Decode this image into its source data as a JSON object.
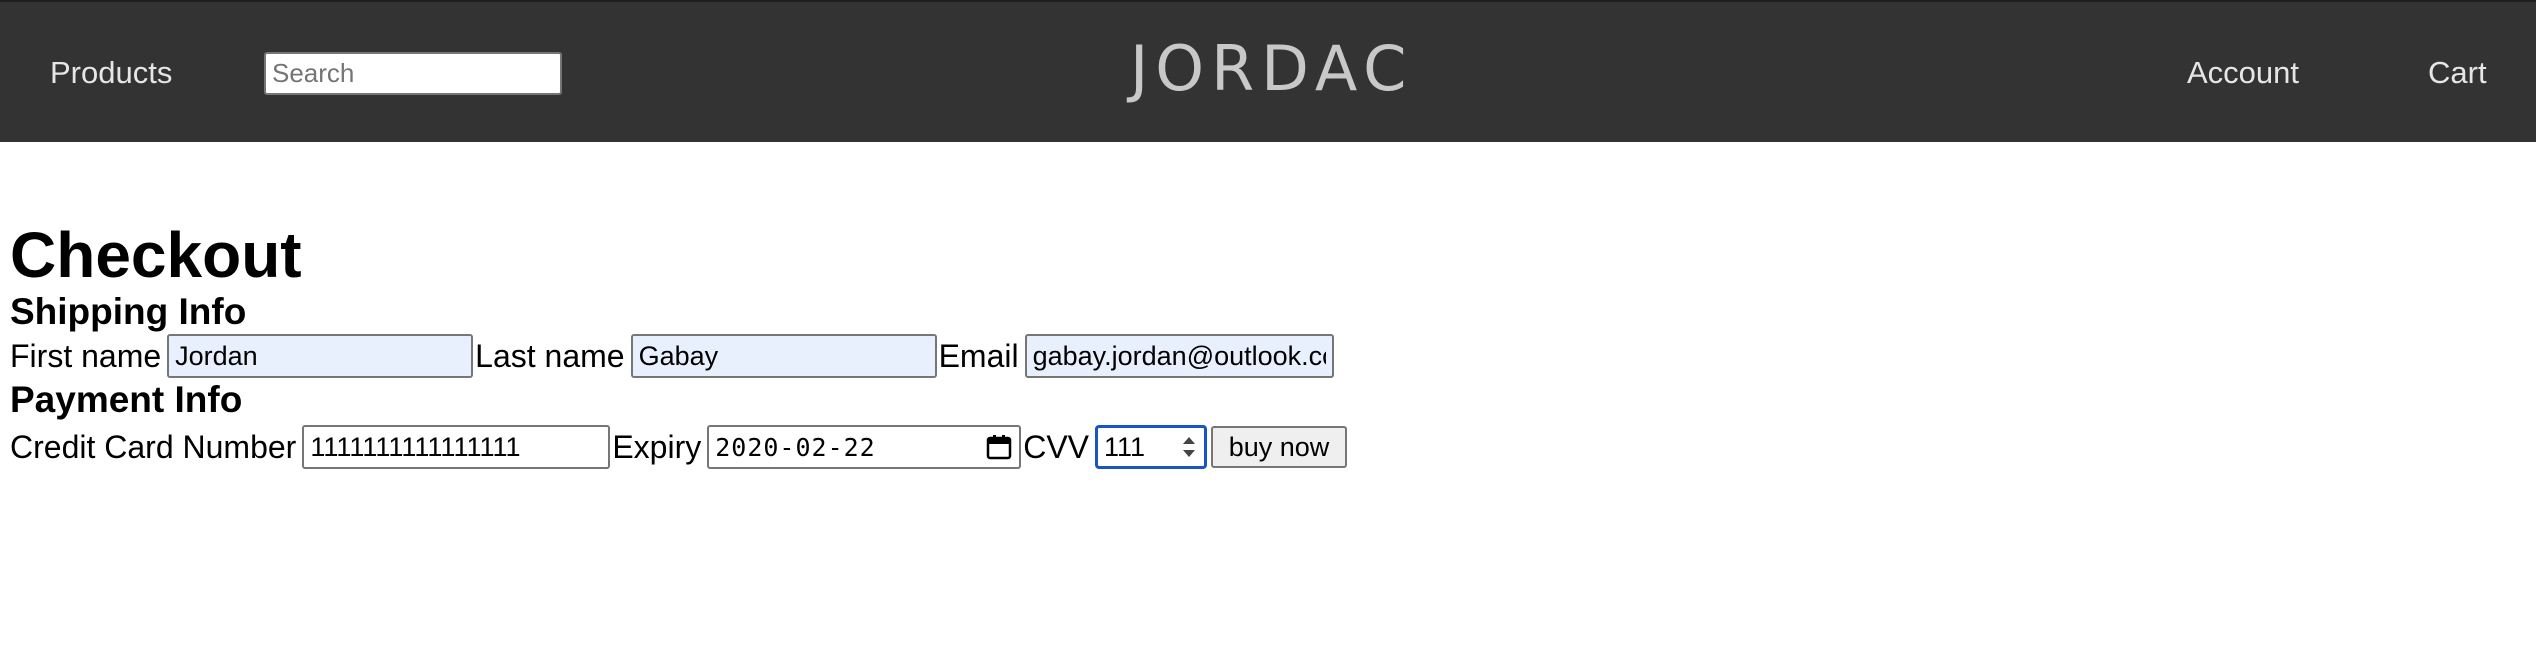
{
  "navbar": {
    "products_label": "Products",
    "search_placeholder": "Search",
    "brand": "JORDAC",
    "account_label": "Account",
    "cart_label": "Cart",
    "background": "#333333"
  },
  "checkout": {
    "title": "Checkout",
    "shipping": {
      "heading": "Shipping Info",
      "first_name_label": "First name",
      "first_name_value": "Jordan",
      "last_name_label": "Last name",
      "last_name_value": "Gabay",
      "email_label": "Email",
      "email_value": "gabay.jordan@outlook.com"
    },
    "payment": {
      "heading": "Payment Info",
      "cc_label": "Credit Card Number",
      "cc_value": "1111111111111111",
      "expiry_label": "Expiry",
      "expiry_value": "2020-02-22",
      "cvv_label": "CVV",
      "cvv_value": "111",
      "buy_label": "buy now"
    },
    "autofill_color": "#e8f0fe",
    "focus_color": "#1a55c4"
  },
  "icons": {
    "expiry_picker": "calendar-icon",
    "cvv_stepper": "spinner-arrows-icon"
  }
}
